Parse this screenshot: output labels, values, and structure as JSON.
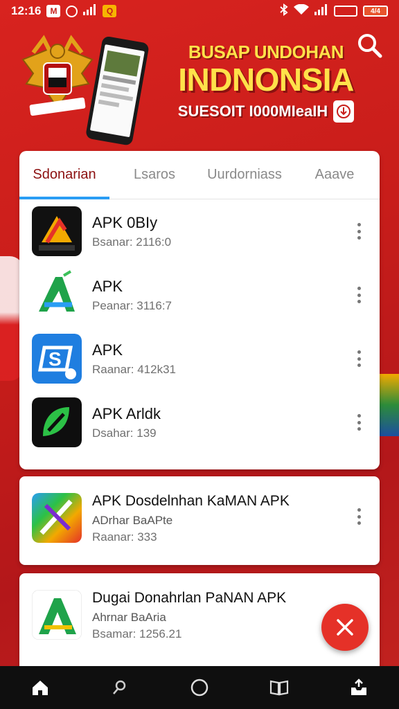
{
  "status_bar": {
    "time": "12:16",
    "mail_glyph": "M",
    "app_glyph": "Q",
    "battery_primary": "",
    "battery_secondary": "4/4"
  },
  "banner": {
    "line1": "BUSAP UNDOHAN",
    "line2": "INDNONSIA",
    "line3": "SUESOIT I000MIeaIH",
    "search_icon": "search-icon"
  },
  "tabs": [
    {
      "label": "Sdonarian",
      "active": true
    },
    {
      "label": "Lsaros",
      "active": false
    },
    {
      "label": "Uurdorniass",
      "active": false
    },
    {
      "label": "Aaave",
      "active": false
    }
  ],
  "apps": [
    {
      "name": "APK 0BIy",
      "meta": "Bsanar: 2116:0",
      "icon": "apk-logo-icon-black"
    },
    {
      "name": "APK",
      "meta": "Peanar: 3116:7",
      "icon": "apk-logo-icon-green"
    },
    {
      "name": "APK",
      "meta": "Raanar: 412k31",
      "icon": "apk-logo-icon-blue"
    },
    {
      "name": "APK Arldk",
      "meta": "Dsahar: 139",
      "icon": "apk-logo-icon-leaf"
    }
  ],
  "featured": [
    {
      "name": "APK Dosdelnhan KaMAN APK",
      "sub": "ADrhar BaAPte",
      "meta": "Raanar: 333",
      "icon": "apk-logo-icon-rainbow"
    },
    {
      "name": "Dugai Donahrlan PaNAN APK",
      "sub": "Ahrnar BaAria",
      "meta": "Bsamar: 1256.21",
      "icon": "apk-logo-icon-green-a"
    }
  ],
  "colors": {
    "accent": "#2a9df4",
    "brand_red": "#c81d1a",
    "fab_red": "#e53128",
    "headline_yellow": "#ffe14a"
  },
  "bottom_nav": [
    "home-icon",
    "search-icon",
    "circle-home-icon",
    "book-icon",
    "inbox-icon"
  ]
}
